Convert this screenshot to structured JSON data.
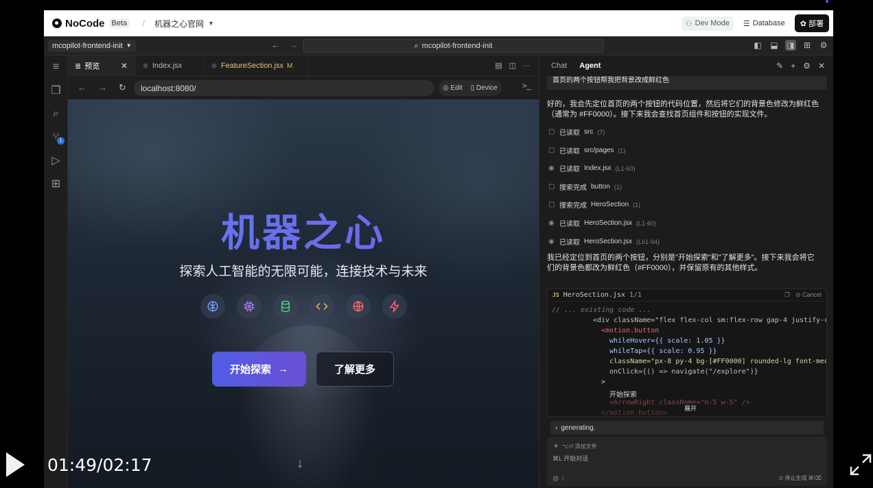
{
  "header": {
    "logo_text": "NoCode",
    "beta": "Beta",
    "separator": "/",
    "project_name": "机器之心官网",
    "dev_mode": "Dev Mode",
    "database": "Database",
    "deploy": "部署"
  },
  "toolbar": {
    "branch": "mcopilot-frontend-init",
    "search_value": "mcopilot-frontend-init"
  },
  "tabs": [
    {
      "label": "预览",
      "active": true
    },
    {
      "label": "Index.jsx"
    },
    {
      "label": "FeatureSection.jsx",
      "modified": "M"
    }
  ],
  "preview_toolbar": {
    "address": "localhost:8080/",
    "edit": "Edit",
    "device": "Device"
  },
  "activity": {
    "badge": "1"
  },
  "hero": {
    "title": "机器之心",
    "subtitle": "探索人工智能的无限可能，连接技术与未来",
    "primary_button": "开始探索",
    "secondary_button": "了解更多",
    "icons": [
      {
        "name": "brain-icon",
        "color": "#6ea1ff"
      },
      {
        "name": "cpu-icon",
        "color": "#b07cff"
      },
      {
        "name": "database-icon",
        "color": "#4fd17a"
      },
      {
        "name": "code-icon",
        "color": "#f0c040"
      },
      {
        "name": "globe-icon",
        "color": "#ff6b6b"
      },
      {
        "name": "lightning-icon",
        "color": "#ff5b7a"
      }
    ]
  },
  "chat": {
    "tab_chat": "Chat",
    "tab_agent": "Agent",
    "user_message": "首页的两个按钮帮我把背景改成鲜红色",
    "reply_1": "好的，我会先定位首页的两个按钮的代码位置，然后将它们的背景色修改为鲜红色（通常为 #FF0000）。接下来我会查找首页组件和按钮的实现文件。",
    "steps": [
      {
        "action": "已读取",
        "target": "src",
        "meta": "(7)",
        "icon": "folder"
      },
      {
        "action": "已读取",
        "target": "src/pages",
        "meta": "(1)",
        "icon": "folder"
      },
      {
        "action": "已读取",
        "target": "Index.jsx",
        "meta": "(L1-60)",
        "icon": "eye"
      },
      {
        "action": "搜索完成",
        "target": "button",
        "meta": "(1)",
        "icon": "folder"
      },
      {
        "action": "搜索完成",
        "target": "HeroSection",
        "meta": "(1)",
        "icon": "folder"
      },
      {
        "action": "已读取",
        "target": "HeroSection.jsx",
        "meta": "(L1-60)",
        "icon": "eye"
      },
      {
        "action": "已读取",
        "target": "HeroSection.jsx",
        "meta": "(L61-94)",
        "icon": "eye"
      }
    ],
    "reply_2": "我已经定位到首页的两个按钮，分别是\"开始探索\"和\"了解更多\"。接下来我会将它们的背景色都改为鲜红色（#FF0000），并保留原有的其他样式。",
    "code": {
      "lang": "JS",
      "file": "HeroSection.jsx",
      "progress": "1/1",
      "cancel": "Cancel",
      "lines": [
        "// ... existing code ...",
        "<div className=\"flex flex-col sm:flex-row gap-4 justify-c",
        "<motion.button",
        "whileHover={{ scale: 1.05 }}",
        "whileTap={{ scale: 0.95 }}",
        "className=\"px-8 py-4 bg-[#FF0000] rounded-lg font-med",
        "onClick={() => navigate(\"/explore\")}",
        ">",
        "开始探索",
        "<ArrowRight className=\"h-5 w-5\" />",
        "</motion.button>"
      ],
      "expand": "展开"
    },
    "generating": "generating.",
    "input": {
      "attach": "⌥⏎ 添加文件",
      "placeholder": "⌘L 开始对话",
      "slash": "/",
      "stop": "停止生成 ⌘⌫"
    }
  },
  "video": {
    "timecode": "01:49/02:17"
  }
}
